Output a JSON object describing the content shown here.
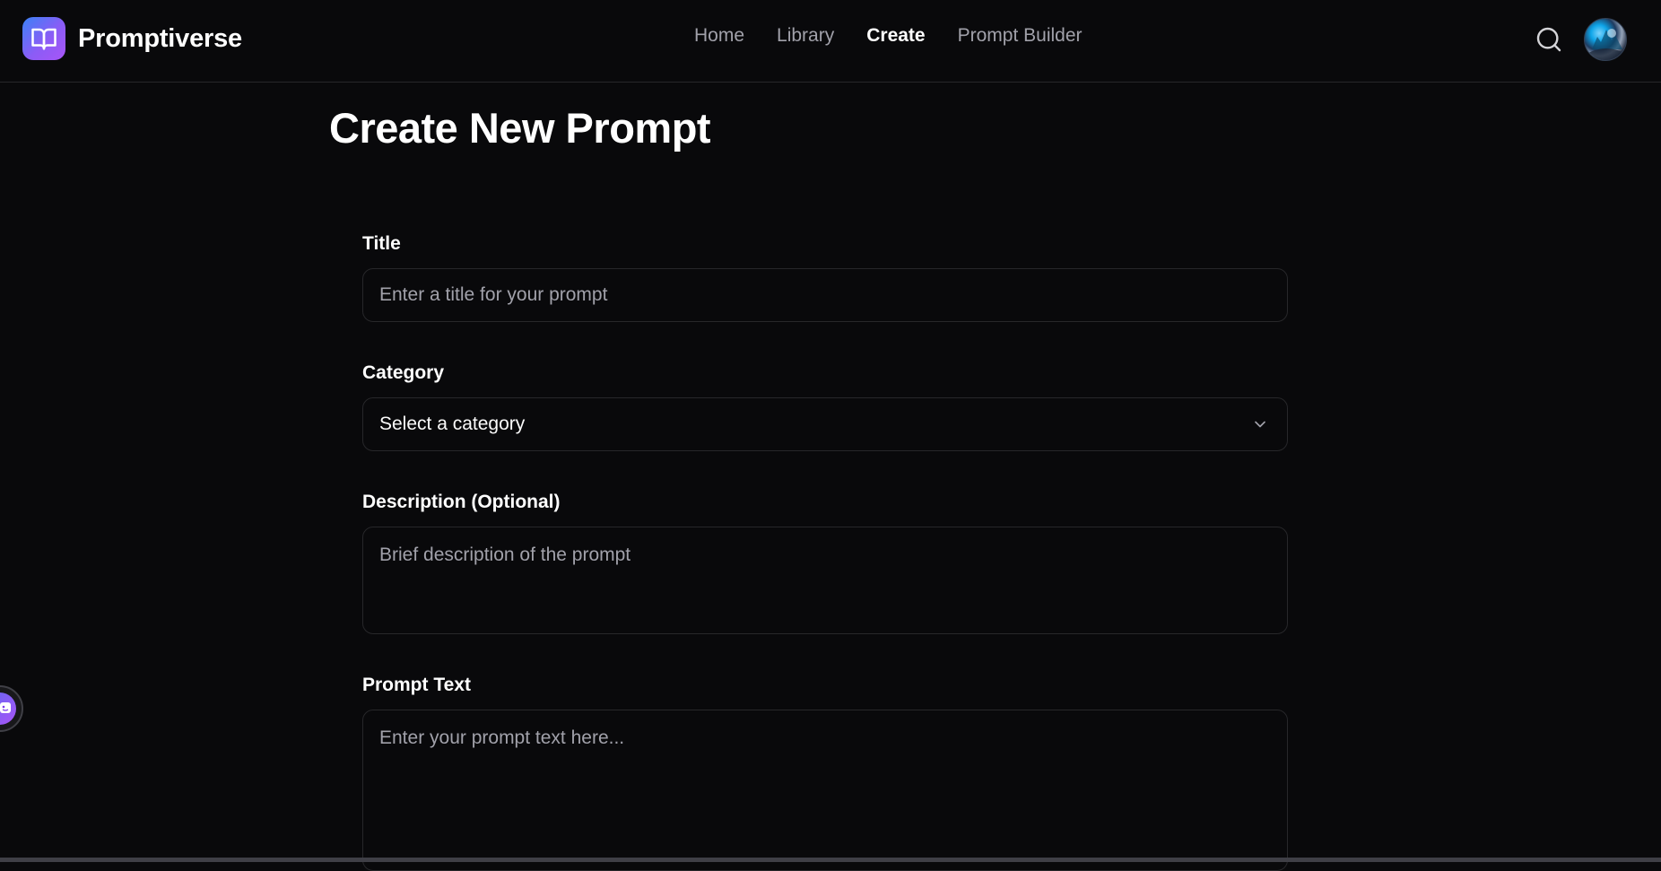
{
  "brand": {
    "name": "Promptiverse",
    "logo_icon": "book-open-icon",
    "accent": "#6366f1"
  },
  "nav": {
    "items": [
      {
        "label": "Home",
        "active": false
      },
      {
        "label": "Library",
        "active": false
      },
      {
        "label": "Create",
        "active": true
      },
      {
        "label": "Prompt Builder",
        "active": false
      }
    ]
  },
  "header": {
    "search_icon": "search-icon",
    "avatar": "user-avatar"
  },
  "page": {
    "title": "Create New Prompt"
  },
  "form": {
    "title": {
      "label": "Title",
      "placeholder": "Enter a title for your prompt",
      "value": ""
    },
    "category": {
      "label": "Category",
      "selected": "Select a category",
      "icon": "chevron-down-icon"
    },
    "description": {
      "label": "Description (Optional)",
      "placeholder": "Brief description of the prompt",
      "value": ""
    },
    "prompt_text": {
      "label": "Prompt Text",
      "placeholder": "Enter your prompt text here...",
      "value": ""
    }
  },
  "floating_widget": {
    "icon": "chat-bot-icon"
  }
}
